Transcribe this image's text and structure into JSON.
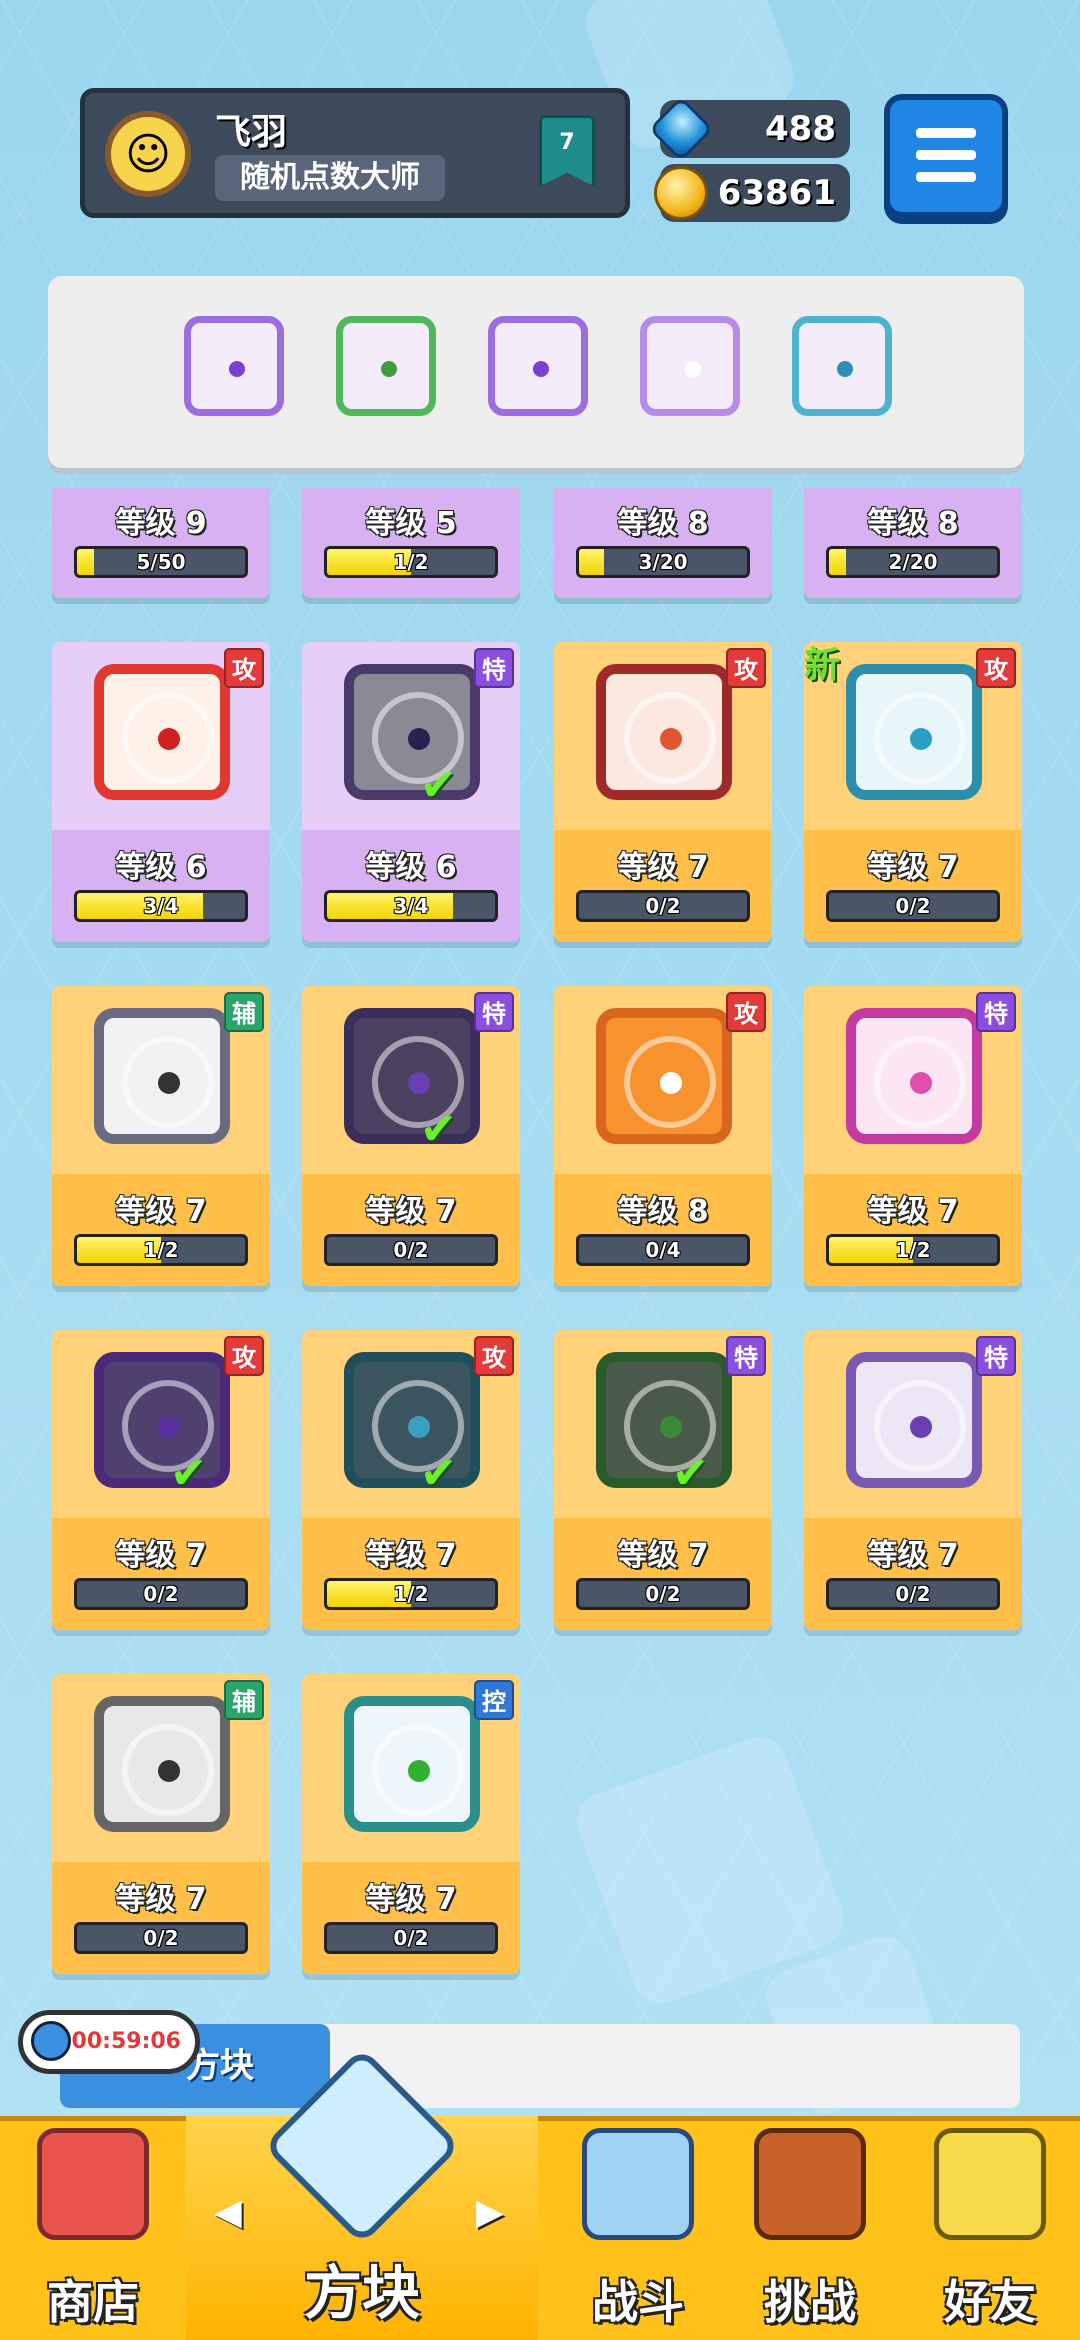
{
  "profile": {
    "name": "飞羽",
    "title": "随机点数大师",
    "rank": "7",
    "avatar_icon": "avatar-icon"
  },
  "currency": {
    "gems": "488",
    "coins": "63861"
  },
  "deck": {
    "dice": [
      {
        "color": "#9b6de0",
        "dot": "#7a3fd0",
        "name": "purple-swirl-die"
      },
      {
        "color": "#4fb85a",
        "dot": "#3e9d3e",
        "name": "green-leaf-die"
      },
      {
        "color": "#9b6de0",
        "dot": "#7a3fd0",
        "name": "purple-eye-die"
      },
      {
        "color": "#b58de8",
        "dot": "#ffffff",
        "name": "purple-crack-die"
      },
      {
        "color": "#4fb3d0",
        "dot": "#2f8fb0",
        "name": "cyan-vortex-die"
      }
    ],
    "levels": [
      {
        "level": "等级 9",
        "progress": "5/50",
        "fill": 0.1
      },
      {
        "level": "等级 5",
        "progress": "1/2",
        "fill": 0.5
      },
      {
        "level": "等级 8",
        "progress": "3/20",
        "fill": 0.15
      },
      {
        "level": "等级 8",
        "progress": "2/20",
        "fill": 0.1
      }
    ]
  },
  "collection": [
    {
      "name": "fire-die",
      "style": "purple",
      "tag": "攻",
      "tag_type": "atk",
      "level": "等级 6",
      "progress": "3/4",
      "fill": 0.75,
      "border": "#e0372e",
      "face": "#fff0e8",
      "dot": "#d02020",
      "checked": false,
      "new": false
    },
    {
      "name": "broken-die",
      "style": "purple",
      "tag": "特",
      "tag_type": "spc",
      "level": "等级 6",
      "progress": "3/4",
      "fill": 0.75,
      "border": "#4a3a6a",
      "face": "#8a8a96",
      "dot": "#2a2050",
      "checked": true,
      "new": false
    },
    {
      "name": "star-die",
      "style": "gold",
      "tag": "攻",
      "tag_type": "atk",
      "level": "等级 7",
      "progress": "0/2",
      "fill": 0,
      "border": "#9e2a2a",
      "face": "#fde8e0",
      "dot": "#e0562e",
      "checked": false,
      "new": false
    },
    {
      "name": "cyan-ice-die",
      "style": "gold",
      "tag": "攻",
      "tag_type": "atk",
      "level": "等级 7",
      "progress": "0/2",
      "fill": 0,
      "border": "#2c8ea8",
      "face": "#e6f6fb",
      "dot": "#2a9fbf",
      "checked": false,
      "new": true,
      "new_label": "新"
    },
    {
      "name": "grey-wolf-die",
      "style": "gold",
      "tag": "辅",
      "tag_type": "sup",
      "level": "等级 7",
      "progress": "1/2",
      "fill": 0.5,
      "border": "#6a6a80",
      "face": "#f2f2f2",
      "dot": "#333333",
      "checked": false,
      "new": false
    },
    {
      "name": "dark-eye-die",
      "style": "gold",
      "tag": "特",
      "tag_type": "spc",
      "level": "等级 7",
      "progress": "0/2",
      "fill": 0,
      "border": "#3a2f5a",
      "face": "#4a4060",
      "dot": "#6a3fb0",
      "checked": true,
      "new": false
    },
    {
      "name": "orange-sun-die",
      "style": "gold",
      "tag": "攻",
      "tag_type": "atk",
      "level": "等级 8",
      "progress": "0/4",
      "fill": 0,
      "border": "#d8661c",
      "face": "#f7922e",
      "dot": "#ffffff",
      "checked": false,
      "new": false
    },
    {
      "name": "pink-arrow-die",
      "style": "gold",
      "tag": "特",
      "tag_type": "spc",
      "level": "等级 7",
      "progress": "1/2",
      "fill": 0.5,
      "border": "#c43aa0",
      "face": "#fde6f4",
      "dot": "#e04fb0",
      "checked": false,
      "new": false
    },
    {
      "name": "purple-orbit-die",
      "style": "gold",
      "tag": "攻",
      "tag_type": "atk",
      "level": "等级 7",
      "progress": "0/2",
      "fill": 0,
      "border": "#4a2a78",
      "face": "#4f4070",
      "dot": "#5a2fa0",
      "checked": true,
      "new": false
    },
    {
      "name": "teal-vortex-die",
      "style": "gold",
      "tag": "攻",
      "tag_type": "atk",
      "level": "等级 7",
      "progress": "1/2",
      "fill": 0.5,
      "border": "#1f4f5a",
      "face": "#3a5560",
      "dot": "#3aa0c0",
      "checked": true,
      "new": false
    },
    {
      "name": "green-vine-die",
      "style": "gold",
      "tag": "特",
      "tag_type": "spc",
      "level": "等级 7",
      "progress": "0/2",
      "fill": 0,
      "border": "#2a5a2a",
      "face": "#4a5a4a",
      "dot": "#3a8a3a",
      "checked": true,
      "new": false
    },
    {
      "name": "lilac-cloud-die",
      "style": "gold",
      "tag": "特",
      "tag_type": "spc",
      "level": "等级 7",
      "progress": "0/2",
      "fill": 0,
      "border": "#7a5ab0",
      "face": "#ece6f6",
      "dot": "#6a3fb0",
      "checked": false,
      "new": false
    },
    {
      "name": "grey-clock-die",
      "style": "gold",
      "tag": "辅",
      "tag_type": "sup",
      "level": "等级 7",
      "progress": "0/2",
      "fill": 0,
      "border": "#666666",
      "face": "#e8e8e8",
      "dot": "#333333",
      "checked": false,
      "new": false
    },
    {
      "name": "wind-die",
      "style": "gold",
      "tag": "控",
      "tag_type": "ctl",
      "level": "等级 7",
      "progress": "0/2",
      "fill": 0,
      "border": "#2a8f8a",
      "face": "#eef6fb",
      "dot": "#2fb02f",
      "checked": false,
      "new": false
    }
  ],
  "event": {
    "label": "方块",
    "timer": "00:59:06"
  },
  "nav": {
    "shop": "商店",
    "dice": "方块",
    "battle": "战斗",
    "challenge": "挑战",
    "friends": "好友"
  }
}
